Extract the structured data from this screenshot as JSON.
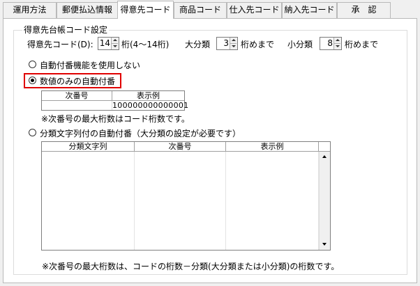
{
  "tabs": [
    {
      "label": "運用方法",
      "active": false
    },
    {
      "label": "郵便払込情報",
      "active": false
    },
    {
      "label": "得意先コード",
      "active": true
    },
    {
      "label": "商品コード",
      "active": false
    },
    {
      "label": "仕入先コード",
      "active": false
    },
    {
      "label": "納入先コード",
      "active": false
    },
    {
      "label": "承　認",
      "active": false
    }
  ],
  "group": {
    "title": "得意先台帳コード設定",
    "digits": {
      "label": "得意先コード(D):",
      "value": "14",
      "suffix": "桁(4～14桁)"
    },
    "major": {
      "label": "大分類",
      "value": "3",
      "suffix": "桁めまで"
    },
    "minor": {
      "label": "小分類",
      "value": "8",
      "suffix": "桁めまで"
    },
    "options": [
      {
        "label": "自動付番機能を使用しない",
        "checked": false
      },
      {
        "label": "数値のみの自動付番",
        "checked": true
      },
      {
        "label": "分類文字列付の自動付番（大分類の設定が必要です）",
        "checked": false
      }
    ],
    "numeric_table": {
      "headers": [
        "次番号",
        "表示例"
      ],
      "row": [
        "",
        "100000000000001"
      ]
    },
    "note1": "※次番号の最大桁数はコード桁数です。",
    "grid": {
      "headers": [
        "分類文字列",
        "次番号",
        "表示例"
      ]
    },
    "note2": "※次番号の最大桁数は、コードの桁数－分類(大分類または小分類)の桁数です。"
  },
  "colors": {
    "highlight": "#e00000",
    "panel_bg": "#ffffff",
    "window_bg": "#f0f0f0"
  }
}
